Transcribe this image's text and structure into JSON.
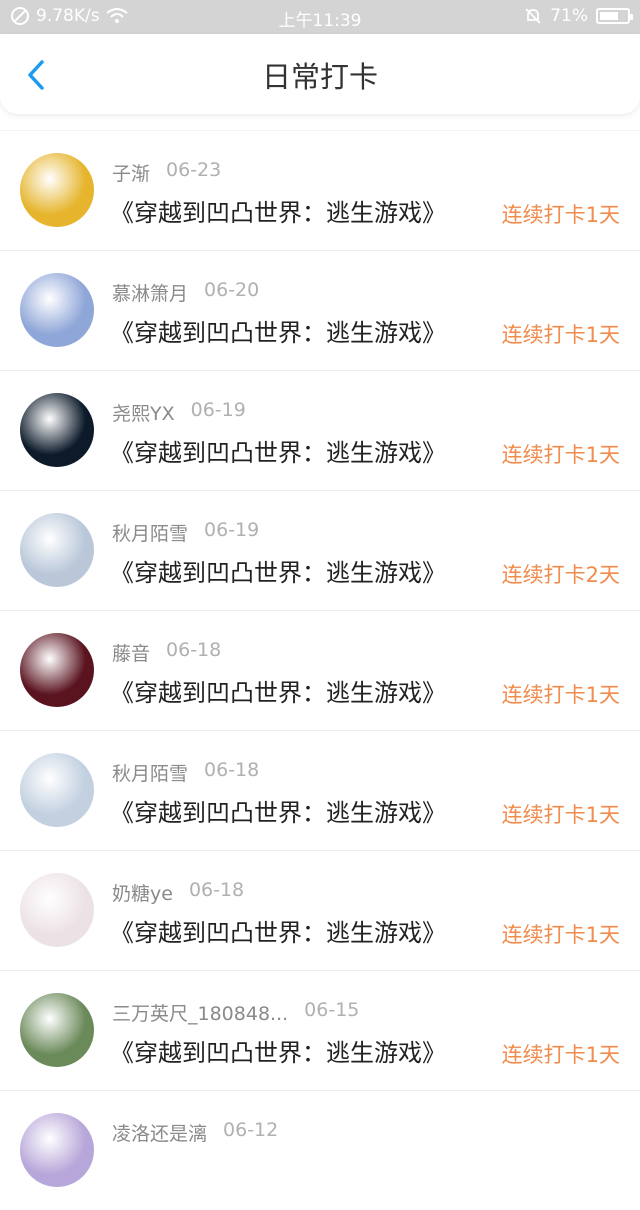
{
  "status_bar": {
    "speed": "9.78K/s",
    "time": "上午11:39",
    "battery": "71%",
    "battery_level": 0.71
  },
  "header": {
    "title": "日常打卡"
  },
  "entries": [
    {
      "name": "子渐",
      "date": "06-23",
      "book": "《穿越到凹凸世界：逃生游戏》",
      "streak": "连续打卡1天"
    },
    {
      "name": "慕淋箫月",
      "date": "06-20",
      "book": "《穿越到凹凸世界：逃生游戏》",
      "streak": "连续打卡1天"
    },
    {
      "name": "尧熙YX",
      "date": "06-19",
      "book": "《穿越到凹凸世界：逃生游戏》",
      "streak": "连续打卡1天"
    },
    {
      "name": "秋月陌雪",
      "date": "06-19",
      "book": "《穿越到凹凸世界：逃生游戏》",
      "streak": "连续打卡2天"
    },
    {
      "name": "藤音",
      "date": "06-18",
      "book": "《穿越到凹凸世界：逃生游戏》",
      "streak": "连续打卡1天"
    },
    {
      "name": "秋月陌雪",
      "date": "06-18",
      "book": "《穿越到凹凸世界：逃生游戏》",
      "streak": "连续打卡1天"
    },
    {
      "name": "奶糖ye",
      "date": "06-18",
      "book": "《穿越到凹凸世界：逃生游戏》",
      "streak": "连续打卡1天"
    },
    {
      "name": "三万英尺_180848...",
      "date": "06-15",
      "book": "《穿越到凹凸世界：逃生游戏》",
      "streak": "连续打卡1天"
    },
    {
      "name": "凌洛还是漓",
      "date": "06-12",
      "book": "",
      "streak": ""
    }
  ],
  "colors": {
    "accent": "#1a9bf0",
    "streak": "#f08b4c",
    "avatars": [
      "#e6b52d",
      "#8fa6d8",
      "#0c1a2a",
      "#b9c7d9",
      "#5a1420",
      "#c2d0e0",
      "#ece2e6",
      "#6b8a5a",
      "#b7a6d9"
    ]
  }
}
